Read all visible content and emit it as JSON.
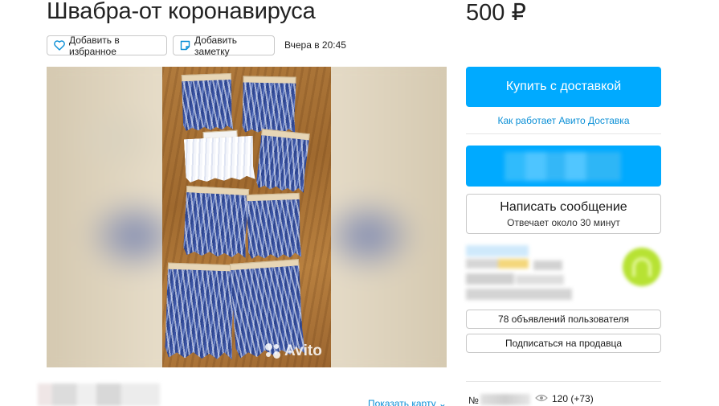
{
  "listing": {
    "title": "Швабра-от коронавируса",
    "price": "500 ₽",
    "date": "Вчера в 20:45"
  },
  "actions": {
    "favorite_label": "Добавить в избранное",
    "note_label": "Добавить заметку"
  },
  "gallery": {
    "watermark": "Avito"
  },
  "sidebar": {
    "buy_label": "Купить с доставкой",
    "delivery_link": "Как работает Авито Доставка",
    "message_title": "Написать сообщение",
    "message_subtitle": "Отвечает около 30 минут",
    "seller_ads_label": "78 объявлений пользователя",
    "subscribe_label": "Подписаться на продавца",
    "item_number_label": "№",
    "views": "120 (+73)"
  },
  "location": {
    "map_link": "Показать карту ⌄"
  },
  "colors": {
    "accent": "#00aaff",
    "link": "#0a8fd6"
  },
  "icons": [
    "heart-icon",
    "note-icon",
    "eye-icon",
    "avito-logo-icon"
  ]
}
